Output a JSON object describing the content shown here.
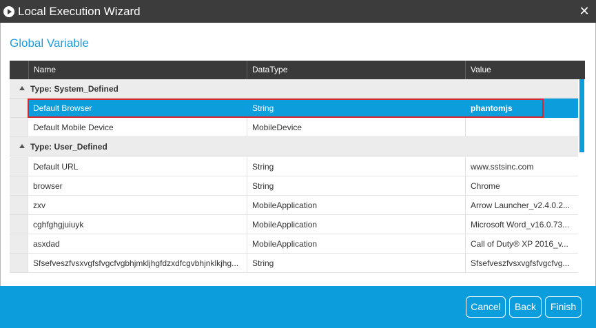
{
  "window": {
    "title": "Local Execution Wizard"
  },
  "section": {
    "title": "Global Variable"
  },
  "grid": {
    "columns": [
      "Name",
      "DataType",
      "Value"
    ],
    "groups": [
      {
        "label": "Type: System_Defined",
        "rows": [
          {
            "name": "Default Browser",
            "datatype": "String",
            "value": "phantomjs",
            "selected": true
          },
          {
            "name": "Default Mobile Device",
            "datatype": "MobileDevice",
            "value": ""
          }
        ]
      },
      {
        "label": "Type: User_Defined",
        "rows": [
          {
            "name": "Default URL",
            "datatype": "String",
            "value": "www.sstsinc.com"
          },
          {
            "name": "browser",
            "datatype": "String",
            "value": "Chrome"
          },
          {
            "name": "zxv",
            "datatype": "MobileApplication",
            "value": "Arrow Launcher_v2.4.0.2..."
          },
          {
            "name": "cghfghgjuiuyk",
            "datatype": "MobileApplication",
            "value": "Microsoft Word_v16.0.73..."
          },
          {
            "name": "asxdad",
            "datatype": "MobileApplication",
            "value": "Call of Duty® XP 2016_v..."
          },
          {
            "name": "Sfsefveszfvsxvgfsfvgcfvgbhjmkljhgfdzxdfcgvbhjnklkjhg...",
            "datatype": "String",
            "value": "Sfsefveszfvsxvgfsfvgcfvg..."
          }
        ]
      }
    ]
  },
  "buttons": {
    "cancel": "Cancel",
    "back": "Back",
    "finish": "Finish"
  },
  "colors": {
    "accent": "#0c9ddc",
    "title_bar": "#3c3c3c",
    "header": "#3a3a3a",
    "highlight": "#d9262c",
    "heading": "#1e9bd7"
  }
}
